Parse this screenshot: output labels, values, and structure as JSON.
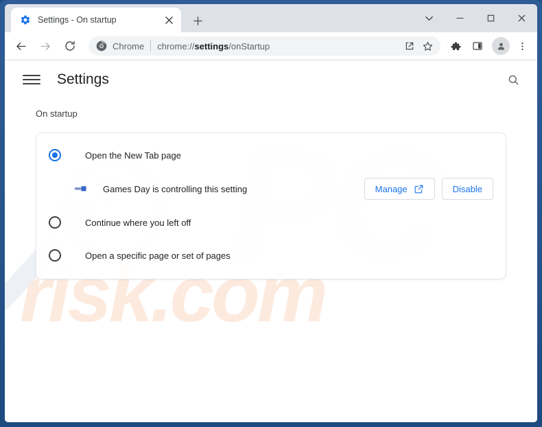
{
  "window": {
    "controls": {
      "chevron_down": "chevron-down",
      "minimize": "minimize",
      "maximize": "maximize",
      "close": "close"
    }
  },
  "tab_strip": {
    "active_tab": {
      "title": "Settings - On startup",
      "favicon": "settings-gear-icon",
      "close_icon": "close-icon"
    },
    "new_tab_label": "+"
  },
  "toolbar": {
    "back_icon": "back-arrow-icon",
    "forward_icon": "forward-arrow-icon",
    "reload_icon": "reload-icon",
    "omnibox": {
      "site_icon": "chrome-logo-icon",
      "site_label": "Chrome",
      "url_prefix": "chrome://",
      "url_bold": "settings",
      "url_suffix": "/onStartup",
      "share_icon": "share-icon",
      "bookmark_icon": "star-icon"
    },
    "extensions_icon": "puzzle-piece-icon",
    "side_panel_icon": "side-panel-icon",
    "avatar_icon": "profile-avatar-icon",
    "menu_icon": "three-dot-menu-icon"
  },
  "settings": {
    "menu_icon": "hamburger-menu-icon",
    "title": "Settings",
    "search_icon": "search-icon",
    "section_label": "On startup",
    "options": [
      {
        "label": "Open the New Tab page",
        "selected": true
      },
      {
        "label": "Continue where you left off",
        "selected": false
      },
      {
        "label": "Open a specific page or set of pages",
        "selected": false
      }
    ],
    "controlled_notice": {
      "extension_icon": "extension-puzzle-icon",
      "text": "Games Day is controlling this setting",
      "manage_label": "Manage",
      "manage_icon": "open-in-new-icon",
      "disable_label": "Disable"
    }
  },
  "watermark": {
    "brand_top": "PC",
    "brand_bottom": "risk.com",
    "glass_icon": "magnifying-glass-logo"
  },
  "colors": {
    "accent_blue": "#1a73e8",
    "window_frame": "#27538a",
    "tab_strip": "#dee1e6",
    "text_primary": "#202124",
    "text_secondary": "#5f6368"
  }
}
